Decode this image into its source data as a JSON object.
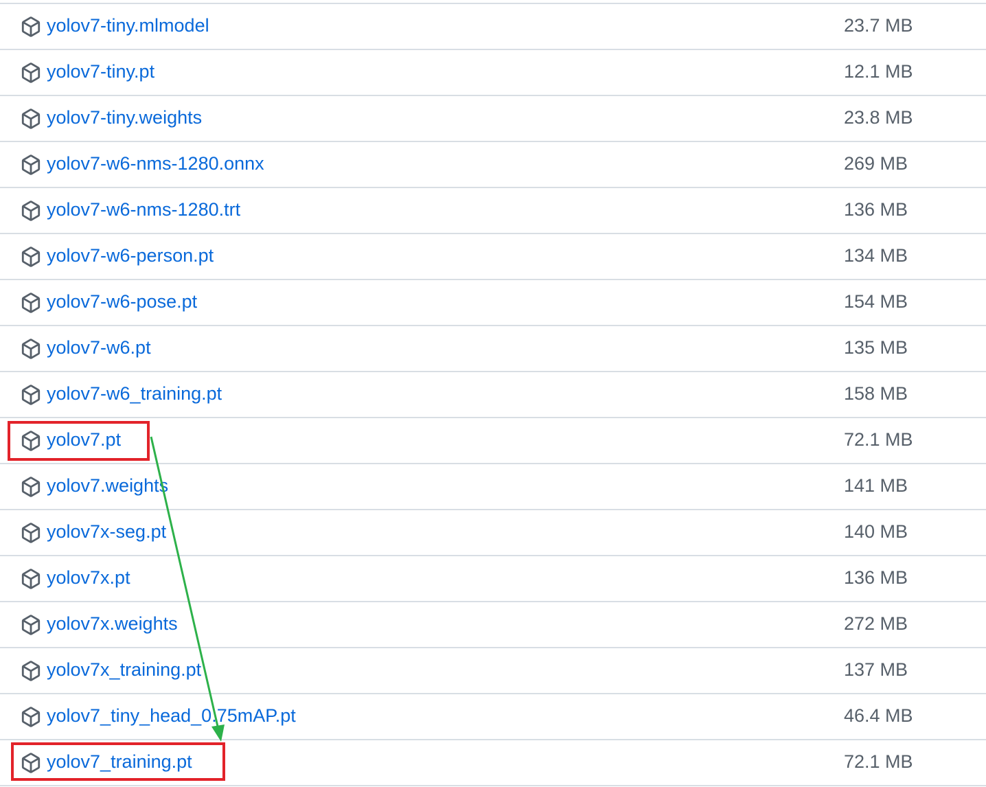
{
  "assets": [
    {
      "name": "yolov7-tiny.mlmodel",
      "size": "23.7 MB"
    },
    {
      "name": "yolov7-tiny.pt",
      "size": "12.1 MB"
    },
    {
      "name": "yolov7-tiny.weights",
      "size": "23.8 MB"
    },
    {
      "name": "yolov7-w6-nms-1280.onnx",
      "size": "269 MB"
    },
    {
      "name": "yolov7-w6-nms-1280.trt",
      "size": "136 MB"
    },
    {
      "name": "yolov7-w6-person.pt",
      "size": "134 MB"
    },
    {
      "name": "yolov7-w6-pose.pt",
      "size": "154 MB"
    },
    {
      "name": "yolov7-w6.pt",
      "size": "135 MB"
    },
    {
      "name": "yolov7-w6_training.pt",
      "size": "158 MB"
    },
    {
      "name": "yolov7.pt",
      "size": "72.1 MB"
    },
    {
      "name": "yolov7.weights",
      "size": "141 MB"
    },
    {
      "name": "yolov7x-seg.pt",
      "size": "140 MB"
    },
    {
      "name": "yolov7x.pt",
      "size": "136 MB"
    },
    {
      "name": "yolov7x.weights",
      "size": "272 MB"
    },
    {
      "name": "yolov7x_training.pt",
      "size": "137 MB"
    },
    {
      "name": "yolov7_tiny_head_0.75mAP.pt",
      "size": "46.4 MB"
    },
    {
      "name": "yolov7_training.pt",
      "size": "72.1 MB"
    }
  ],
  "annotations": {
    "highlight_color": "#e2232a",
    "arrow_color": "#2db14a",
    "highlighted_assets": [
      "yolov7.pt",
      "yolov7_training.pt"
    ],
    "arrow_from": "yolov7.pt",
    "arrow_to": "yolov7_training.pt"
  },
  "icons": {
    "asset_icon": "package-icon"
  }
}
